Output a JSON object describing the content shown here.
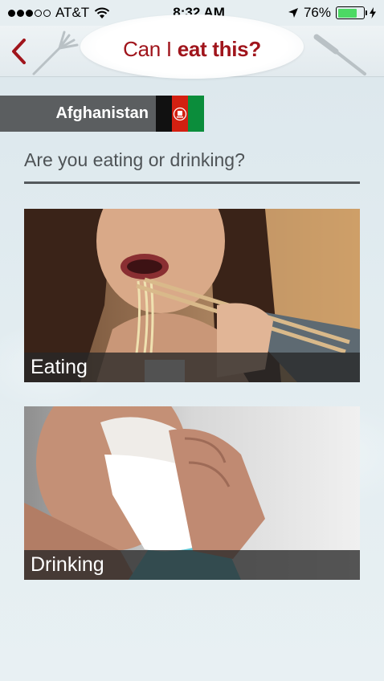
{
  "status_bar": {
    "carrier": "AT&T",
    "time": "8:32 AM",
    "battery_percent": "76%",
    "battery_level": 0.76
  },
  "header": {
    "title_part1": "Can I",
    "title_part2": "eat this?"
  },
  "country": {
    "name": "Afghanistan"
  },
  "question": "Are you eating or drinking?",
  "options": [
    {
      "label": "Eating"
    },
    {
      "label": "Drinking"
    }
  ],
  "colors": {
    "brand_red": "#a0151c",
    "country_bar": "#5b5e60",
    "background": "#e6eef1"
  }
}
